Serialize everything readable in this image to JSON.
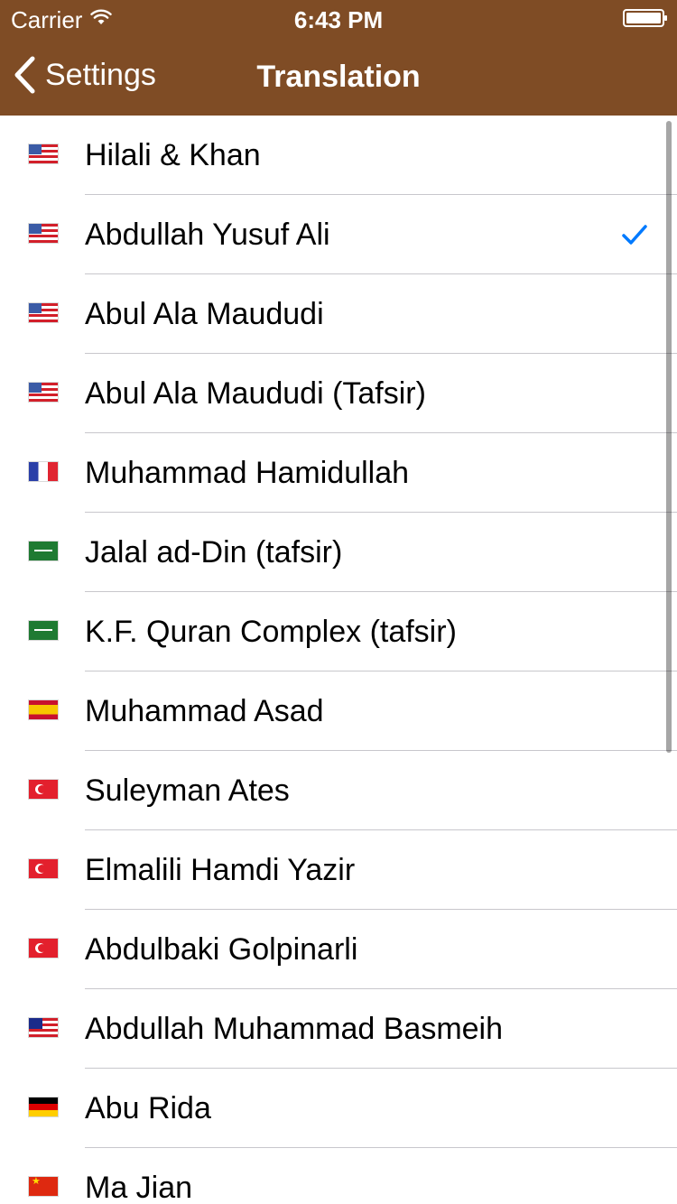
{
  "status_bar": {
    "carrier": "Carrier",
    "time": "6:43 PM"
  },
  "nav": {
    "back_label": "Settings",
    "title": "Translation"
  },
  "rows": [
    {
      "label": "Hilali & Khan",
      "flag": "us",
      "selected": false
    },
    {
      "label": "Abdullah Yusuf Ali",
      "flag": "us",
      "selected": true
    },
    {
      "label": "Abul Ala Maududi",
      "flag": "us",
      "selected": false
    },
    {
      "label": "Abul Ala Maududi (Tafsir)",
      "flag": "us",
      "selected": false
    },
    {
      "label": "Muhammad Hamidullah",
      "flag": "fr",
      "selected": false
    },
    {
      "label": "Jalal ad-Din (tafsir)",
      "flag": "sa",
      "selected": false
    },
    {
      "label": "K.F. Quran Complex (tafsir)",
      "flag": "sa",
      "selected": false
    },
    {
      "label": "Muhammad Asad",
      "flag": "es",
      "selected": false
    },
    {
      "label": "Suleyman Ates",
      "flag": "tr",
      "selected": false
    },
    {
      "label": "Elmalili Hamdi Yazir",
      "flag": "tr",
      "selected": false
    },
    {
      "label": "Abdulbaki Golpinarli",
      "flag": "tr",
      "selected": false
    },
    {
      "label": "Abdullah Muhammad Basmeih",
      "flag": "my",
      "selected": false
    },
    {
      "label": "Abu Rida",
      "flag": "de",
      "selected": false
    },
    {
      "label": "Ma Jian",
      "flag": "cn",
      "selected": false
    }
  ],
  "colors": {
    "nav_background": "#7f4c25",
    "checkmark": "#007aff"
  }
}
